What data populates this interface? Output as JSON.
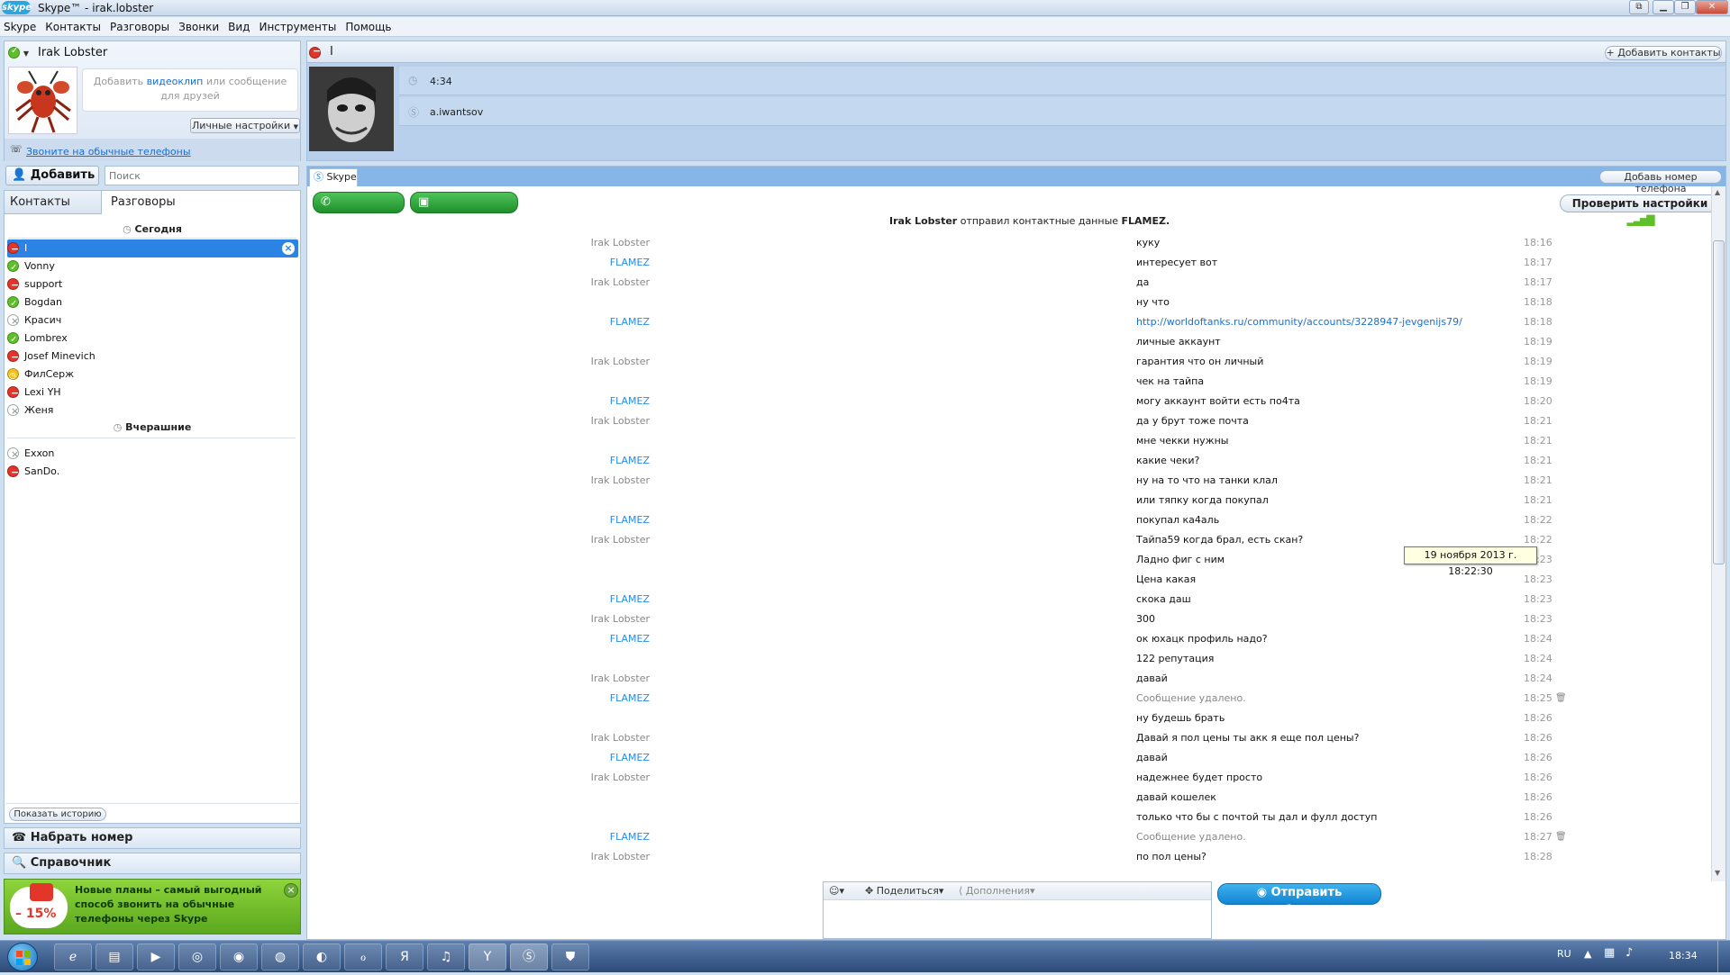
{
  "window": {
    "app_logo": "skype",
    "title": "Skype™ - irak.lobster"
  },
  "menu": [
    "Skype",
    "Контакты",
    "Разговоры",
    "Звонки",
    "Вид",
    "Инструменты",
    "Помощь"
  ],
  "profile": {
    "name": "Irak Lobster",
    "mood_placeholder_pre": "Добавить ",
    "mood_placeholder_link": "видеоклип",
    "mood_placeholder_post": " или сообщение для друзей",
    "settings_button": "Личные настройки",
    "call_phones_link": "Звоните на обычные телефоны"
  },
  "toolbar": {
    "add_button": "Добавить",
    "search_placeholder": "Поиск"
  },
  "tabs": {
    "contacts": "Контакты",
    "conversations": "Разговоры"
  },
  "groups": {
    "today": "Сегодня",
    "yesterday": "Вчерашние"
  },
  "today_contacts": [
    {
      "name": "I",
      "status": "red"
    },
    {
      "name": "Vonny",
      "status": "green"
    },
    {
      "name": "support",
      "status": "red"
    },
    {
      "name": "Bogdan",
      "status": "green"
    },
    {
      "name": "Красич",
      "status": "gray"
    },
    {
      "name": "Lombrex",
      "status": "green"
    },
    {
      "name": "Josef Minevich",
      "status": "red"
    },
    {
      "name": "ФилСерж",
      "status": "yellow"
    },
    {
      "name": "Lexi YH",
      "status": "red"
    },
    {
      "name": "Женя",
      "status": "gray"
    }
  ],
  "yesterday_contacts": [
    {
      "name": "Exxon",
      "status": "gray"
    },
    {
      "name": "SanDo.",
      "status": "red"
    }
  ],
  "show_history_button": "Показать историю",
  "dial_number": "Набрать номер",
  "directory": "Справочник",
  "promo": {
    "discount": "– 15%",
    "text": "Новые планы – самый выгодный способ звонить на обычные телефоны через Skype"
  },
  "contact_header": {
    "name": "I",
    "add_contacts_button": "Добавить контакты",
    "local_time": "4:34",
    "skype_name": "a.iwantsov"
  },
  "chat_tab": {
    "label": "Skype",
    "add_phone_button": "Добавь номер телефона"
  },
  "call_buttons": {
    "call": "Позвонить",
    "video": "Видеозвонок",
    "check_settings": "Проверить настройки"
  },
  "chat_notice": {
    "sender": "Irak Lobster",
    "action": " отправил контактные данные ",
    "target": "FLAMEZ."
  },
  "messages": [
    {
      "sender": "Irak Lobster",
      "text": "куку",
      "time": "18:16"
    },
    {
      "sender": "FLAMEZ",
      "text": "интересует вот",
      "time": "18:17"
    },
    {
      "sender": "Irak Lobster",
      "text": "да",
      "time": "18:17"
    },
    {
      "sender": "",
      "text": "ну что",
      "time": "18:18"
    },
    {
      "sender": "FLAMEZ",
      "text": "http://worldoftanks.ru/community/accounts/3228947-jevgenijs79/",
      "time": "18:18",
      "link": true
    },
    {
      "sender": "",
      "text": "личные аккаунт",
      "time": "18:19"
    },
    {
      "sender": "Irak Lobster",
      "text": "гарантия что он личный",
      "time": "18:19"
    },
    {
      "sender": "",
      "text": "чек на тайпа",
      "time": "18:19"
    },
    {
      "sender": "FLAMEZ",
      "text": "могу  аккаунт войти есть по4та",
      "time": "18:20"
    },
    {
      "sender": "Irak Lobster",
      "text": "да у брут тоже почта",
      "time": "18:21"
    },
    {
      "sender": "",
      "text": "мне чекки нужны",
      "time": "18:21"
    },
    {
      "sender": "FLAMEZ",
      "text": "какие чеки?",
      "time": "18:21"
    },
    {
      "sender": "Irak Lobster",
      "text": "ну на то что на танки клал",
      "time": "18:21"
    },
    {
      "sender": "",
      "text": "или тяпку когда покупал",
      "time": "18:21"
    },
    {
      "sender": "FLAMEZ",
      "text": "покупал ка4аль",
      "time": "18:22"
    },
    {
      "sender": "Irak Lobster",
      "text": "Тайпа59 когда брал, есть скан?",
      "time": "18:22"
    },
    {
      "sender": "",
      "text": "Ладно фиг с ним",
      "time": "18:23"
    },
    {
      "sender": "",
      "text": "Цена какая",
      "time": "18:23"
    },
    {
      "sender": "FLAMEZ",
      "text": "скока даш",
      "time": "18:23"
    },
    {
      "sender": "Irak Lobster",
      "text": "300",
      "time": "18:23"
    },
    {
      "sender": "FLAMEZ",
      "text": "ок юхацк профиль надо?",
      "time": "18:24"
    },
    {
      "sender": "",
      "text": "122 репутация",
      "time": "18:24"
    },
    {
      "sender": "Irak Lobster",
      "text": "давай",
      "time": "18:24"
    },
    {
      "sender": "FLAMEZ",
      "text": "Сообщение удалено.",
      "time": "18:25",
      "deleted": true
    },
    {
      "sender": "",
      "text": "ну будешь брать",
      "time": "18:26"
    },
    {
      "sender": "Irak Lobster",
      "text": "Давай я пол цены ты акк я еще пол цены?",
      "time": "18:26"
    },
    {
      "sender": "FLAMEZ",
      "text": "давай",
      "time": "18:26"
    },
    {
      "sender": "Irak Lobster",
      "text": "надежнее будет просто",
      "time": "18:26"
    },
    {
      "sender": "",
      "text": "давай кошелек",
      "time": "18:26"
    },
    {
      "sender": "",
      "text": "только что бы с почтой ты дал и фулл доступ",
      "time": "18:26"
    },
    {
      "sender": "FLAMEZ",
      "text": "Сообщение удалено.",
      "time": "18:27",
      "deleted": true
    },
    {
      "sender": "Irak Lobster",
      "text": "по пол цены?",
      "time": "18:28"
    }
  ],
  "tooltip": "19 ноября 2013 г. 18:22:30",
  "composer": {
    "share": "Поделиться",
    "extras": "Дополнения",
    "send_button": "Отправить сообщение"
  },
  "taskbar": {
    "language": "RU",
    "clock": "18:34"
  }
}
